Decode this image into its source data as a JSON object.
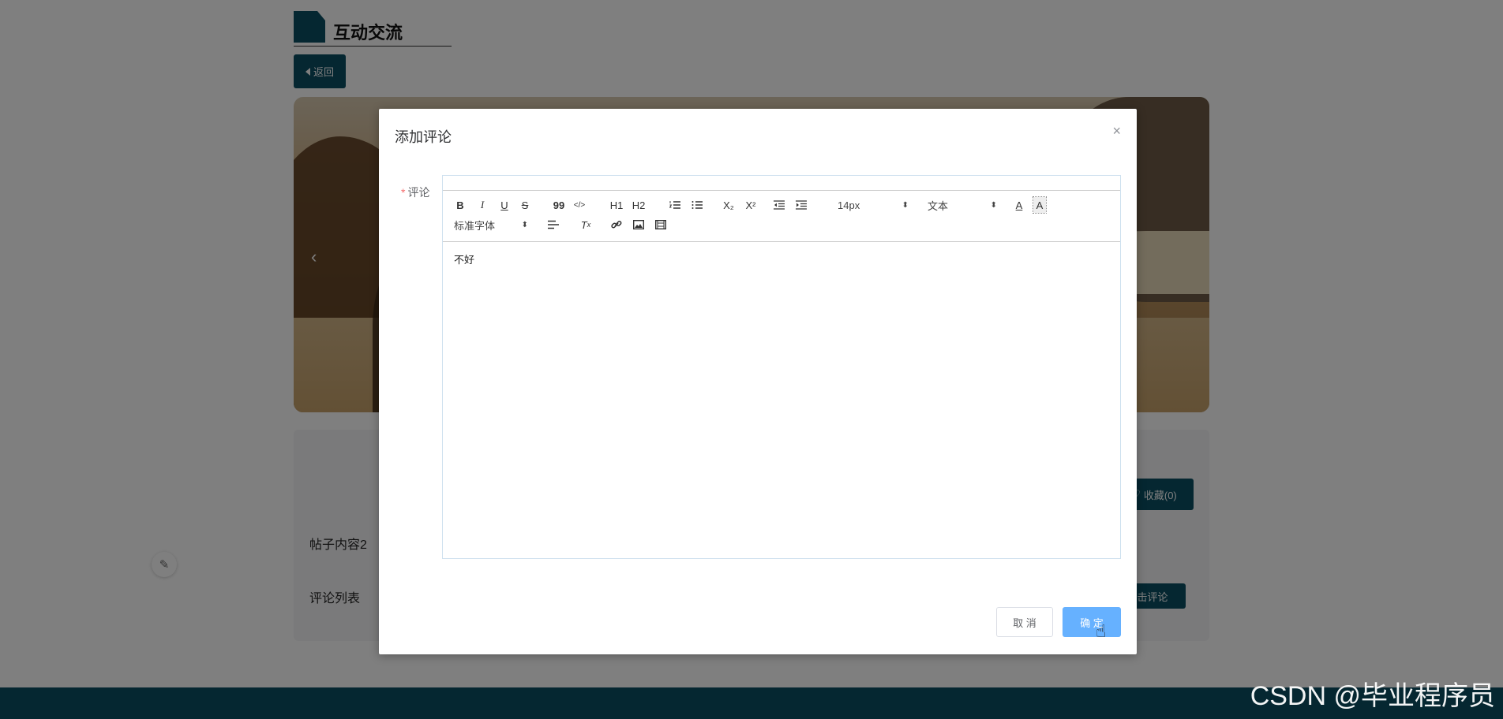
{
  "page": {
    "title": "互动交流",
    "back_label": "返回",
    "post_content": "帖子内容2",
    "comment_list_label": "评论列表",
    "favorite_label": "收藏(0)",
    "comment_button_label": "击评论",
    "watermark": "CSDN @毕业程序员"
  },
  "dialog": {
    "title": "添加评论",
    "close_icon": "×",
    "field_label": "评论",
    "required_mark": "*",
    "editor_text": "不好",
    "toolbar": {
      "bold": "B",
      "italic": "I",
      "underline": "U",
      "strike": "S",
      "blockquote": "99",
      "code": "</>",
      "h1": "H1",
      "h2": "H2",
      "subscript": "X₂",
      "superscript": "X²",
      "size_select": "14px",
      "header_select": "文本",
      "font_select": "标准字体"
    },
    "cancel_label": "取 消",
    "ok_label": "确 定"
  },
  "colors": {
    "brand": "#0b4f63",
    "primary_light": "#66b1ff",
    "overlay": "rgba(0,0,0,0.5)"
  }
}
